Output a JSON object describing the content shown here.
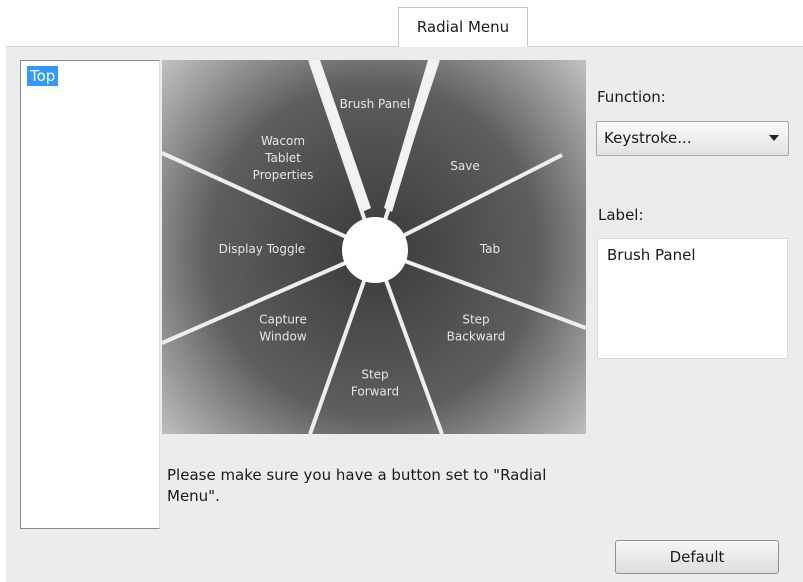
{
  "tab": {
    "label": "Radial Menu"
  },
  "tree": {
    "items": [
      {
        "label": "Top",
        "selected": true
      }
    ]
  },
  "radial_menu": {
    "segments": [
      {
        "label": "Brush Panel",
        "selected": true
      },
      {
        "label": "Save"
      },
      {
        "label": "Tab"
      },
      {
        "label": "Step\nBackward"
      },
      {
        "label": "Step\nForward"
      },
      {
        "label": "Capture\nWindow"
      },
      {
        "label": "Display Toggle"
      },
      {
        "label": "Wacom\nTablet\nProperties"
      }
    ]
  },
  "message": "Please make sure you have a button set to \"Radial Menu\".",
  "function": {
    "label": "Function:",
    "value": "Keystroke..."
  },
  "label_field": {
    "label": "Label:",
    "value": "Brush Panel"
  },
  "default_button": {
    "label": "Default"
  },
  "colors": {
    "selection": "#3399ff",
    "wheel_center": "#ffffff",
    "wheel_dark": "#3c3c3c"
  }
}
